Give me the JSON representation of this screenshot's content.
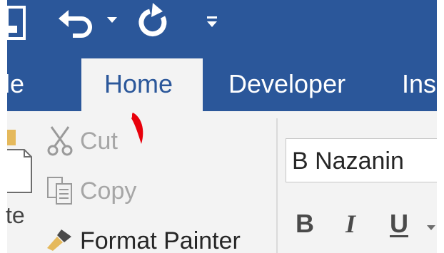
{
  "quick_access": {
    "icons": [
      "save-icon",
      "undo-icon",
      "dropdown-arrow-icon",
      "redo-icon",
      "customize-qat-icon"
    ]
  },
  "tabs": {
    "file": "le",
    "home": "Home",
    "developer": "Developer",
    "insert": "Inse",
    "active": "Home"
  },
  "clipboard": {
    "paste_label": "te",
    "cut_label": "Cut",
    "copy_label": "Copy",
    "format_painter_label": "Format Painter"
  },
  "font": {
    "name": "B Nazanin",
    "bold_label": "B",
    "italic_label": "I",
    "underline_label": "U"
  },
  "colors": {
    "ribbon_blue": "#2b579a",
    "ribbon_body": "#f3f3f3",
    "disabled_text": "#a6a6a6",
    "annotation_red": "#e8000b"
  }
}
